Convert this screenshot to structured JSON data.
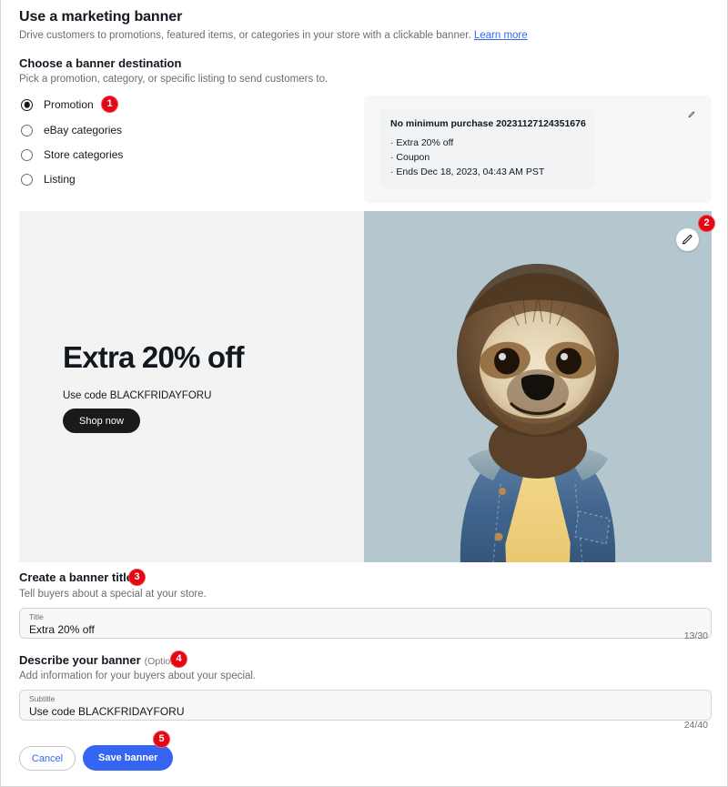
{
  "header": {
    "title": "Use a marketing banner",
    "subtitle_text": "Drive customers to promotions, featured items, or categories in your store with a clickable banner.",
    "learn_more": "Learn more"
  },
  "destination": {
    "title": "Choose a banner destination",
    "subtitle": "Pick a promotion, category, or specific listing to send customers to.",
    "options": [
      {
        "label": "Promotion",
        "selected": true
      },
      {
        "label": "eBay categories",
        "selected": false
      },
      {
        "label": "Store categories",
        "selected": false
      },
      {
        "label": "Listing",
        "selected": false
      }
    ]
  },
  "promotion_card": {
    "title": "No minimum purchase 20231127124351676",
    "bullets": [
      "· Extra 20% off",
      "· Coupon",
      "· Ends Dec 18, 2023, 04:43 AM PST"
    ],
    "edit_icon": "pencil-icon"
  },
  "banner_preview": {
    "headline": "Extra 20% off",
    "subtext": "Use code BLACKFRIDAYFORU",
    "cta_label": "Shop now",
    "left_bg": "#f3f3f3",
    "right_bg": "#b4c7ce",
    "image_alt": "sloth-in-denim-jacket",
    "edit_icon": "pencil-icon"
  },
  "banner_title_section": {
    "title": "Create a banner title",
    "subtitle": "Tell buyers about a special at your store.",
    "field_legend": "Title",
    "field_value": "Extra 20% off",
    "counter": "13/30"
  },
  "banner_desc_section": {
    "title": "Describe your banner",
    "optional": "(Optional)",
    "subtitle": "Add information for your buyers about your special.",
    "field_legend": "Subtitle",
    "field_value": "Use code BLACKFRIDAYFORU",
    "counter": "24/40"
  },
  "footer": {
    "cancel_label": "Cancel",
    "save_label": "Save banner"
  },
  "badges": [
    "1",
    "2",
    "3",
    "4",
    "5"
  ],
  "colors": {
    "accent_blue": "#3665f3",
    "badge_red": "#e30613",
    "text_dark": "#111820",
    "text_muted": "#6d6d6d"
  }
}
